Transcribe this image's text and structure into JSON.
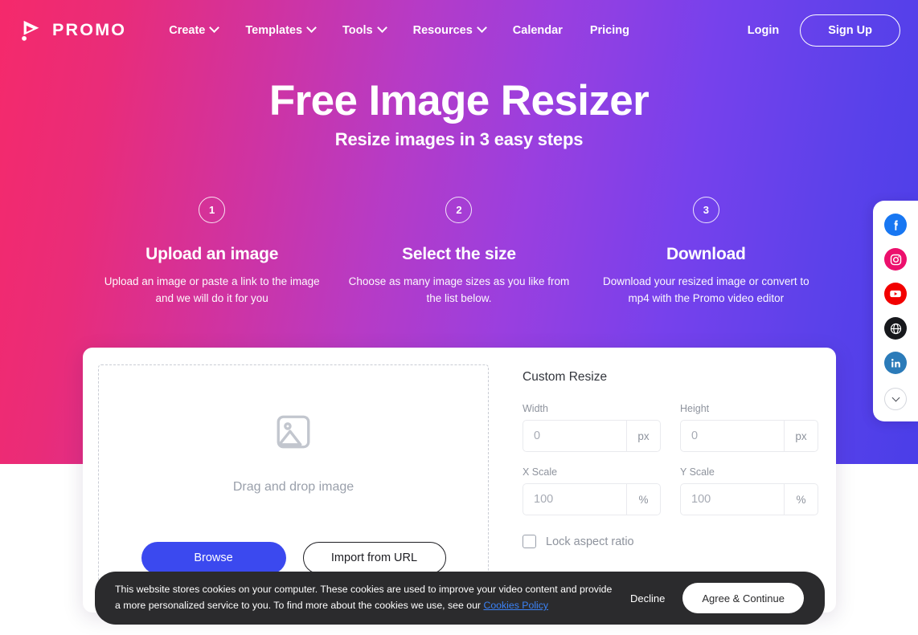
{
  "brand": {
    "name": "PROMO",
    "logo_icon": "play-triangle-logo"
  },
  "nav": {
    "items": [
      {
        "label": "Create",
        "has_dropdown": true
      },
      {
        "label": "Templates",
        "has_dropdown": true
      },
      {
        "label": "Tools",
        "has_dropdown": true
      },
      {
        "label": "Resources",
        "has_dropdown": true
      },
      {
        "label": "Calendar",
        "has_dropdown": false
      },
      {
        "label": "Pricing",
        "has_dropdown": false
      }
    ],
    "login_label": "Login",
    "signup_label": "Sign Up"
  },
  "hero": {
    "title": "Free Image Resizer",
    "subtitle": "Resize images in 3 easy steps"
  },
  "steps": [
    {
      "number": "1",
      "title": "Upload an image",
      "description": "Upload an image or paste a link to the image and we will do it for you"
    },
    {
      "number": "2",
      "title": "Select the size",
      "description": "Choose as many image sizes as you like from the list below."
    },
    {
      "number": "3",
      "title": "Download",
      "description": "Download your resized image or convert to mp4 with the Promo video editor"
    }
  ],
  "dropzone": {
    "placeholder_icon": "image-placeholder-icon",
    "text": "Drag and drop image",
    "browse_label": "Browse",
    "import_label": "Import from URL"
  },
  "custom_resize": {
    "title": "Custom Resize",
    "fields": [
      {
        "label": "Width",
        "value": "",
        "placeholder": "0",
        "unit": "px"
      },
      {
        "label": "Height",
        "value": "",
        "placeholder": "0",
        "unit": "px"
      },
      {
        "label": "X Scale",
        "value": "",
        "placeholder": "100",
        "unit": "%"
      },
      {
        "label": "Y Scale",
        "value": "",
        "placeholder": "100",
        "unit": "%"
      }
    ],
    "lock_label": "Lock aspect ratio",
    "lock_checked": false
  },
  "social_rail": {
    "items": [
      {
        "name": "facebook",
        "icon": "facebook-icon"
      },
      {
        "name": "instagram",
        "icon": "instagram-icon"
      },
      {
        "name": "youtube",
        "icon": "youtube-icon"
      },
      {
        "name": "website",
        "icon": "globe-icon"
      },
      {
        "name": "linkedin",
        "icon": "linkedin-icon"
      }
    ],
    "collapse_icon": "chevron-down-icon"
  },
  "cookie_banner": {
    "text_part1": "This website stores cookies on your computer. These cookies are used to improve your video content and provide a more personalized service to you. To find more about the cookies we use, see our ",
    "link_label": "Cookies Policy",
    "decline_label": "Decline",
    "agree_label": "Agree & Continue"
  },
  "colors": {
    "gradient_start": "#f5296b",
    "gradient_end": "#4a3ee8",
    "primary_button": "#3b49ef",
    "link": "#3b82f6",
    "banner_bg": "#2b2b2d"
  }
}
